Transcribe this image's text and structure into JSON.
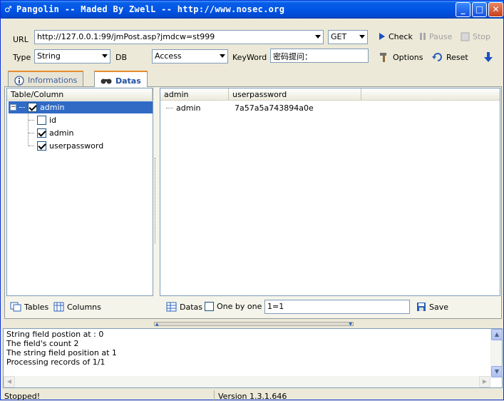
{
  "window": {
    "title": "Pangolin -- Maded By ZwelL -- http://www.nosec.org",
    "minimize": "_",
    "maximize": "□",
    "close": "✕"
  },
  "toolbar": {
    "url_label": "URL",
    "url_value": "http://127.0.0.1:99/jmPost.asp?jmdcw=st999",
    "method_value": "GET",
    "check_label": "Check",
    "pause_label": "Pause",
    "stop_label": "Stop",
    "type_label": "Type",
    "type_value": "String",
    "db_label": "DB",
    "db_value": "Access",
    "keyword_label": "KeyWord",
    "keyword_value": "密码提问：",
    "options_label": "Options",
    "reset_label": "Reset"
  },
  "tabs": [
    {
      "label": "Informations",
      "icon": "info-icon"
    },
    {
      "label": "Datas",
      "icon": "binoculars-icon"
    }
  ],
  "tree": {
    "header": "Table/Column",
    "table": {
      "name": "admin",
      "checked": true
    },
    "columns": [
      {
        "name": "id",
        "checked": false
      },
      {
        "name": "admin",
        "checked": true
      },
      {
        "name": "userpassword",
        "checked": true
      }
    ]
  },
  "left_footer": {
    "tables_label": "Tables",
    "columns_label": "Columns"
  },
  "data_grid": {
    "headers": [
      "admin",
      "userpassword"
    ],
    "rows": [
      [
        "admin",
        "7a57a5a743894a0e"
      ]
    ]
  },
  "right_footer": {
    "datas_label": "Datas",
    "one_by_one_label": "One by one",
    "condition_value": "1=1",
    "save_label": "Save"
  },
  "log": [
    "String field postion at : 0",
    "The field's count 2",
    "The string field position at 1",
    "Processing records of 1/1"
  ],
  "status": {
    "state": "Stopped!",
    "version": "Version 1.3.1.646"
  },
  "colors": {
    "titlebar": "#0055e5",
    "selection": "#316ac5",
    "tab_accent": "#e68b2c"
  }
}
